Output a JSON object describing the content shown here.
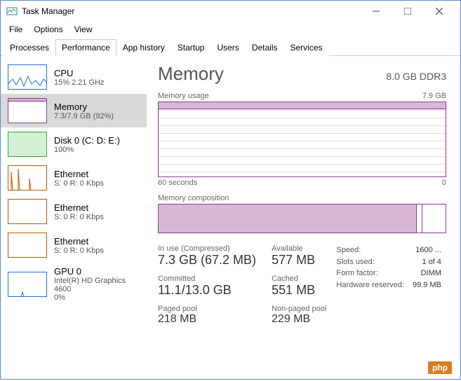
{
  "window": {
    "title": "Task Manager"
  },
  "menu": {
    "file": "File",
    "options": "Options",
    "view": "View"
  },
  "tabs": {
    "processes": "Processes",
    "performance": "Performance",
    "apphistory": "App history",
    "startup": "Startup",
    "users": "Users",
    "details": "Details",
    "services": "Services"
  },
  "sidebar": {
    "cpu": {
      "name": "CPU",
      "sub": "15% 2.21 GHz",
      "color": "#2a70c8"
    },
    "memory": {
      "name": "Memory",
      "sub": "7.3/7.9 GB (92%)",
      "color": "#8b3a8b"
    },
    "disk": {
      "name": "Disk 0 (C: D: E:)",
      "sub": "100%",
      "color": "#3aa03a"
    },
    "eth0": {
      "name": "Ethernet",
      "sub": "S: 0 R: 0 Kbps",
      "color": "#b35900"
    },
    "eth1": {
      "name": "Ethernet",
      "sub": "S: 0 R: 0 Kbps",
      "color": "#b35900"
    },
    "eth2": {
      "name": "Ethernet",
      "sub": "S: 0 R: 0 Kbps",
      "color": "#b35900"
    },
    "gpu": {
      "name": "GPU 0",
      "sub": "Intel(R) HD Graphics 4600",
      "sub2": "0%",
      "color": "#2a70c8"
    }
  },
  "main": {
    "title": "Memory",
    "capacity": "8.0 GB DDR3",
    "usage_label": "Memory usage",
    "usage_max": "7.9 GB",
    "xaxis_left": "60 seconds",
    "xaxis_right": "0",
    "composition_label": "Memory composition",
    "inuse_lbl": "In use (Compressed)",
    "inuse": "7.3 GB (67.2 MB)",
    "avail_lbl": "Available",
    "avail": "577 MB",
    "committed_lbl": "Committed",
    "committed": "11.1/13.0 GB",
    "cached_lbl": "Cached",
    "cached": "551 MB",
    "paged_lbl": "Paged pool",
    "paged": "218 MB",
    "nonpaged_lbl": "Non-paged pool",
    "nonpaged": "229 MB",
    "speed_lbl": "Speed:",
    "speed": "1600 ...",
    "slots_lbl": "Slots used:",
    "slots": "1 of 4",
    "form_lbl": "Form factor:",
    "form": "DIMM",
    "hwres_lbl": "Hardware reserved:",
    "hwres": "99.9 MB"
  },
  "chart_data": {
    "type": "line",
    "title": "Memory usage",
    "ylabel": "GB",
    "ylim": [
      0,
      7.9
    ],
    "xlabel": "seconds",
    "xlim": [
      60,
      0
    ],
    "series": [
      {
        "name": "In use",
        "values_approx_constant": 7.3
      }
    ],
    "composition": {
      "in_use_gb": 7.3,
      "modified_gb": 0.05,
      "standby_gb": 0.55,
      "free_gb": 0.0,
      "total_gb": 7.9
    }
  },
  "watermark": "php"
}
